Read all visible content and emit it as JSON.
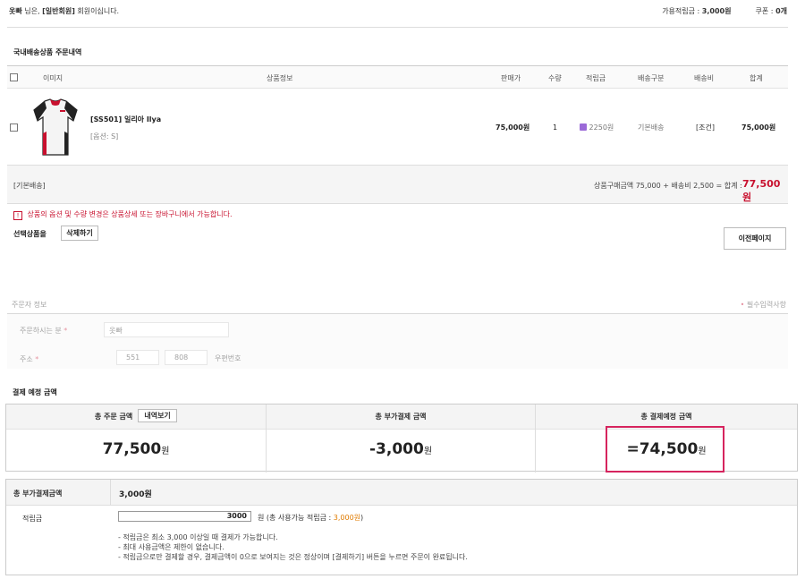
{
  "topbar": {
    "user_name": "옷빠",
    "greeting_mid": " 님은, ",
    "member_level": "[일반회원]",
    "greeting_end": " 회원이십니다.",
    "points_label": "가용적립금 : ",
    "points_value": "3,000원",
    "coupon_label": "쿠폰 : ",
    "coupon_value": "0개"
  },
  "order_section": {
    "title": "국내배송상품 주문내역",
    "headers": {
      "image": "이미지",
      "info": "상품정보",
      "price": "판매가",
      "qty": "수량",
      "points": "적립금",
      "ship_type": "배송구분",
      "ship_fee": "배송비",
      "total": "합계"
    },
    "item": {
      "name": "[SS501] 일리아 Ilya",
      "option": "[옵션: S]",
      "price": "75,000원",
      "qty": "1",
      "points": "2250원",
      "ship_type": "기본배송",
      "ship_fee": "[조건]",
      "total": "75,000원"
    },
    "subtotal": {
      "ship_label": "[기본배송]",
      "summary": "상품구매금액 75,000 + 배송비 2,500 = 합계 : ",
      "total": "77,500원"
    },
    "notice": "상품의 옵션 및 수량 변경은 상품상세 또는 장바구니에서 가능합니다.",
    "selected_label": "선택상품을",
    "delete_button": "삭제하기",
    "prev_button": "이전페이지"
  },
  "orderer": {
    "title": "주문자 정보",
    "required_note": "필수입력사항",
    "name_label": "주문하시는 분",
    "name_value": "옷빠",
    "address_label": "주소",
    "zip1": "551",
    "zip2": "808",
    "zip_button": "우편번호"
  },
  "payment": {
    "title": "결제 예정 금액",
    "order_total_label": "총 주문 금액",
    "detail_button": "내역보기",
    "order_total": "77,500",
    "extra_label": "총 부가결제 금액",
    "extra_total": "-3,000",
    "final_label": "총 결제예정 금액",
    "final_total": "=74,500",
    "won": "원"
  },
  "extra_payment": {
    "label": "총 부가결제금액",
    "value": "3,000원",
    "points_label": "적립금",
    "points_input": "3000",
    "points_hint_pre": "원 (총 사용가능 적립금 : ",
    "points_hint_value": "3,000원",
    "points_hint_post": ")",
    "notes": [
      "- 적립금은 최소 3,000 이상일 때 결제가 가능합니다.",
      "- 최대 사용금액은 제한이 없습니다.",
      "- 적립금으로만 결제할 경우, 결제금액이 0으로 보여지는 것은 정상이며 [결제하기] 버튼을 누르면 주문이 완료됩니다."
    ]
  },
  "colors": {
    "accent_red": "#c8102e",
    "highlight_pink": "#d6245e",
    "points_orange": "#e07b00"
  }
}
